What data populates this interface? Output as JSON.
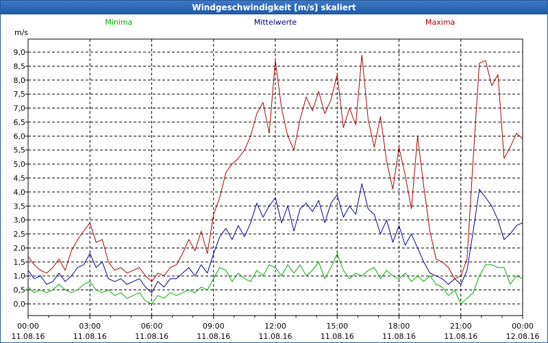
{
  "window": {
    "title": "Windgeschwindigkeit [m/s] skaliert"
  },
  "chart_data": {
    "type": "line",
    "title": "Windgeschwindigkeit [m/s] skaliert",
    "ylabel": "m/s",
    "ylim": [
      0,
      9
    ],
    "xlim_hours": [
      0,
      24
    ],
    "grid": true,
    "legend_placement": "top",
    "y_ticks": [
      "0,0",
      "0,5",
      "1,0",
      "1,5",
      "2,0",
      "2,5",
      "3,0",
      "3,5",
      "4,0",
      "4,5",
      "5,0",
      "5,5",
      "6,0",
      "6,5",
      "7,0",
      "7,5",
      "8,0",
      "8,5",
      "9,0"
    ],
    "x_ticks": [
      {
        "time": "00:00",
        "date": "11.08.16"
      },
      {
        "time": "03:00",
        "date": "11.08.16"
      },
      {
        "time": "06:00",
        "date": "11.08.16"
      },
      {
        "time": "09:00",
        "date": "11.08.16"
      },
      {
        "time": "12:00",
        "date": "11.08.16"
      },
      {
        "time": "15:00",
        "date": "11.08.16"
      },
      {
        "time": "18:00",
        "date": "11.08.16"
      },
      {
        "time": "21:00",
        "date": "11.08.16"
      },
      {
        "time": "00:00",
        "date": "12.08.16"
      }
    ],
    "series": [
      {
        "name": "Minima",
        "color": "#00aa00",
        "points": [
          [
            0,
            0.6
          ],
          [
            0.3,
            0.4
          ],
          [
            0.6,
            0.5
          ],
          [
            0.9,
            0.4
          ],
          [
            1.2,
            0.5
          ],
          [
            1.5,
            0.7
          ],
          [
            1.8,
            0.5
          ],
          [
            2.1,
            0.4
          ],
          [
            2.4,
            0.5
          ],
          [
            2.7,
            0.7
          ],
          [
            3.0,
            0.8
          ],
          [
            3.3,
            0.5
          ],
          [
            3.6,
            0.4
          ],
          [
            3.9,
            0.5
          ],
          [
            4.2,
            0.3
          ],
          [
            4.5,
            0.4
          ],
          [
            4.8,
            0.2
          ],
          [
            5.1,
            0.3
          ],
          [
            5.4,
            0.4
          ],
          [
            5.7,
            0.1
          ],
          [
            6.0,
            0.0
          ],
          [
            6.3,
            0.3
          ],
          [
            6.6,
            0.2
          ],
          [
            6.9,
            0.4
          ],
          [
            7.2,
            0.3
          ],
          [
            7.5,
            0.4
          ],
          [
            7.8,
            0.5
          ],
          [
            8.1,
            0.4
          ],
          [
            8.4,
            0.6
          ],
          [
            8.7,
            0.5
          ],
          [
            9.0,
            0.9
          ],
          [
            9.3,
            1.3
          ],
          [
            9.6,
            1.2
          ],
          [
            9.9,
            0.8
          ],
          [
            10.2,
            1.1
          ],
          [
            10.5,
            0.9
          ],
          [
            10.8,
            0.8
          ],
          [
            11.1,
            1.2
          ],
          [
            11.4,
            1.0
          ],
          [
            11.7,
            1.4
          ],
          [
            12.0,
            1.3
          ],
          [
            12.3,
            1.0
          ],
          [
            12.6,
            1.4
          ],
          [
            12.9,
            1.1
          ],
          [
            13.2,
            1.4
          ],
          [
            13.5,
            1.0
          ],
          [
            13.8,
            1.2
          ],
          [
            14.1,
            1.5
          ],
          [
            14.4,
            0.9
          ],
          [
            14.7,
            1.3
          ],
          [
            15.0,
            1.8
          ],
          [
            15.3,
            1.2
          ],
          [
            15.6,
            0.9
          ],
          [
            15.9,
            1.1
          ],
          [
            16.2,
            1.0
          ],
          [
            16.5,
            1.2
          ],
          [
            16.8,
            1.3
          ],
          [
            17.1,
            0.9
          ],
          [
            17.4,
            1.2
          ],
          [
            17.7,
            1.0
          ],
          [
            18.0,
            0.9
          ],
          [
            18.3,
            1.1
          ],
          [
            18.6,
            0.8
          ],
          [
            18.9,
            1.0
          ],
          [
            19.2,
            0.8
          ],
          [
            19.5,
            1.0
          ],
          [
            19.8,
            0.7
          ],
          [
            20.1,
            0.6
          ],
          [
            20.4,
            0.3
          ],
          [
            20.7,
            0.5
          ],
          [
            21.0,
            0.0
          ],
          [
            21.3,
            0.2
          ],
          [
            21.6,
            0.4
          ],
          [
            21.9,
            1.0
          ],
          [
            22.2,
            1.4
          ],
          [
            22.5,
            1.4
          ],
          [
            22.8,
            1.3
          ],
          [
            23.1,
            1.3
          ],
          [
            23.4,
            0.7
          ],
          [
            23.7,
            1.0
          ],
          [
            24.0,
            0.9
          ]
        ]
      },
      {
        "name": "Mittelwerte",
        "color": "#00008b",
        "points": [
          [
            0,
            1.2
          ],
          [
            0.3,
            0.9
          ],
          [
            0.6,
            1.0
          ],
          [
            0.9,
            0.7
          ],
          [
            1.2,
            0.8
          ],
          [
            1.5,
            1.1
          ],
          [
            1.8,
            0.8
          ],
          [
            2.1,
            1.0
          ],
          [
            2.4,
            1.3
          ],
          [
            2.7,
            1.4
          ],
          [
            3.0,
            1.8
          ],
          [
            3.3,
            1.3
          ],
          [
            3.6,
            1.5
          ],
          [
            3.9,
            0.9
          ],
          [
            4.2,
            0.8
          ],
          [
            4.5,
            0.9
          ],
          [
            4.8,
            0.7
          ],
          [
            5.1,
            0.8
          ],
          [
            5.4,
            0.9
          ],
          [
            5.7,
            0.6
          ],
          [
            6.0,
            0.4
          ],
          [
            6.3,
            0.8
          ],
          [
            6.6,
            0.6
          ],
          [
            6.9,
            0.9
          ],
          [
            7.2,
            0.9
          ],
          [
            7.5,
            1.1
          ],
          [
            7.8,
            1.3
          ],
          [
            8.1,
            1.0
          ],
          [
            8.4,
            1.4
          ],
          [
            8.7,
            1.1
          ],
          [
            9.0,
            1.8
          ],
          [
            9.3,
            2.4
          ],
          [
            9.6,
            2.7
          ],
          [
            9.9,
            2.3
          ],
          [
            10.2,
            2.8
          ],
          [
            10.5,
            2.4
          ],
          [
            10.8,
            2.9
          ],
          [
            11.1,
            3.6
          ],
          [
            11.4,
            3.1
          ],
          [
            11.7,
            3.5
          ],
          [
            12.0,
            3.8
          ],
          [
            12.3,
            2.9
          ],
          [
            12.6,
            3.5
          ],
          [
            12.9,
            2.6
          ],
          [
            13.2,
            3.4
          ],
          [
            13.5,
            3.6
          ],
          [
            13.8,
            3.3
          ],
          [
            14.1,
            3.7
          ],
          [
            14.4,
            2.9
          ],
          [
            14.7,
            3.6
          ],
          [
            15.0,
            3.9
          ],
          [
            15.3,
            3.1
          ],
          [
            15.6,
            3.5
          ],
          [
            15.9,
            3.2
          ],
          [
            16.2,
            4.3
          ],
          [
            16.5,
            3.4
          ],
          [
            16.8,
            3.2
          ],
          [
            17.1,
            2.5
          ],
          [
            17.4,
            3.0
          ],
          [
            17.7,
            2.2
          ],
          [
            18.0,
            2.8
          ],
          [
            18.3,
            2.1
          ],
          [
            18.6,
            2.5
          ],
          [
            18.9,
            2.0
          ],
          [
            19.2,
            1.5
          ],
          [
            19.5,
            1.1
          ],
          [
            19.8,
            1.0
          ],
          [
            20.1,
            0.9
          ],
          [
            20.4,
            0.7
          ],
          [
            20.7,
            0.9
          ],
          [
            21.0,
            0.7
          ],
          [
            21.3,
            1.2
          ],
          [
            21.6,
            2.6
          ],
          [
            21.9,
            4.1
          ],
          [
            22.2,
            3.8
          ],
          [
            22.5,
            3.5
          ],
          [
            22.8,
            3.0
          ],
          [
            23.1,
            2.3
          ],
          [
            23.4,
            2.5
          ],
          [
            23.7,
            2.8
          ],
          [
            24.0,
            2.9
          ]
        ]
      },
      {
        "name": "Maxima",
        "color": "#aa0000",
        "points": [
          [
            0,
            1.7
          ],
          [
            0.3,
            1.4
          ],
          [
            0.6,
            1.2
          ],
          [
            0.9,
            1.1
          ],
          [
            1.2,
            1.3
          ],
          [
            1.5,
            1.6
          ],
          [
            1.8,
            1.2
          ],
          [
            2.1,
            1.9
          ],
          [
            2.4,
            2.3
          ],
          [
            2.7,
            2.6
          ],
          [
            3.0,
            2.9
          ],
          [
            3.3,
            2.2
          ],
          [
            3.6,
            2.3
          ],
          [
            3.9,
            1.5
          ],
          [
            4.2,
            1.2
          ],
          [
            4.5,
            1.3
          ],
          [
            4.8,
            1.1
          ],
          [
            5.1,
            1.2
          ],
          [
            5.4,
            1.3
          ],
          [
            5.7,
            1.0
          ],
          [
            6.0,
            0.8
          ],
          [
            6.3,
            1.1
          ],
          [
            6.6,
            1.0
          ],
          [
            6.9,
            1.3
          ],
          [
            7.2,
            1.4
          ],
          [
            7.5,
            1.8
          ],
          [
            7.8,
            2.3
          ],
          [
            8.1,
            1.9
          ],
          [
            8.4,
            2.6
          ],
          [
            8.7,
            1.8
          ],
          [
            9.0,
            3.2
          ],
          [
            9.3,
            3.8
          ],
          [
            9.6,
            4.7
          ],
          [
            9.9,
            5.0
          ],
          [
            10.2,
            5.2
          ],
          [
            10.5,
            5.5
          ],
          [
            10.8,
            6.0
          ],
          [
            11.1,
            6.8
          ],
          [
            11.4,
            7.2
          ],
          [
            11.7,
            6.1
          ],
          [
            12.0,
            8.7
          ],
          [
            12.3,
            7.0
          ],
          [
            12.6,
            6.0
          ],
          [
            12.9,
            5.5
          ],
          [
            13.2,
            6.6
          ],
          [
            13.5,
            7.4
          ],
          [
            13.8,
            6.9
          ],
          [
            14.1,
            7.6
          ],
          [
            14.4,
            6.8
          ],
          [
            14.7,
            7.3
          ],
          [
            15.0,
            8.2
          ],
          [
            15.3,
            6.3
          ],
          [
            15.6,
            7.0
          ],
          [
            15.9,
            6.4
          ],
          [
            16.2,
            8.9
          ],
          [
            16.5,
            6.6
          ],
          [
            16.8,
            5.6
          ],
          [
            17.1,
            6.7
          ],
          [
            17.4,
            5.1
          ],
          [
            17.7,
            4.1
          ],
          [
            18.0,
            5.6
          ],
          [
            18.3,
            4.6
          ],
          [
            18.6,
            3.4
          ],
          [
            18.9,
            6.0
          ],
          [
            19.2,
            4.2
          ],
          [
            19.5,
            2.6
          ],
          [
            19.8,
            1.6
          ],
          [
            20.1,
            1.5
          ],
          [
            20.4,
            1.3
          ],
          [
            20.7,
            0.9
          ],
          [
            21.0,
            1.0
          ],
          [
            21.3,
            1.6
          ],
          [
            21.6,
            5.2
          ],
          [
            21.9,
            8.6
          ],
          [
            22.2,
            8.7
          ],
          [
            22.5,
            7.8
          ],
          [
            22.8,
            8.2
          ],
          [
            23.1,
            5.2
          ],
          [
            23.4,
            5.6
          ],
          [
            23.7,
            6.1
          ],
          [
            24.0,
            5.9
          ]
        ]
      }
    ]
  }
}
